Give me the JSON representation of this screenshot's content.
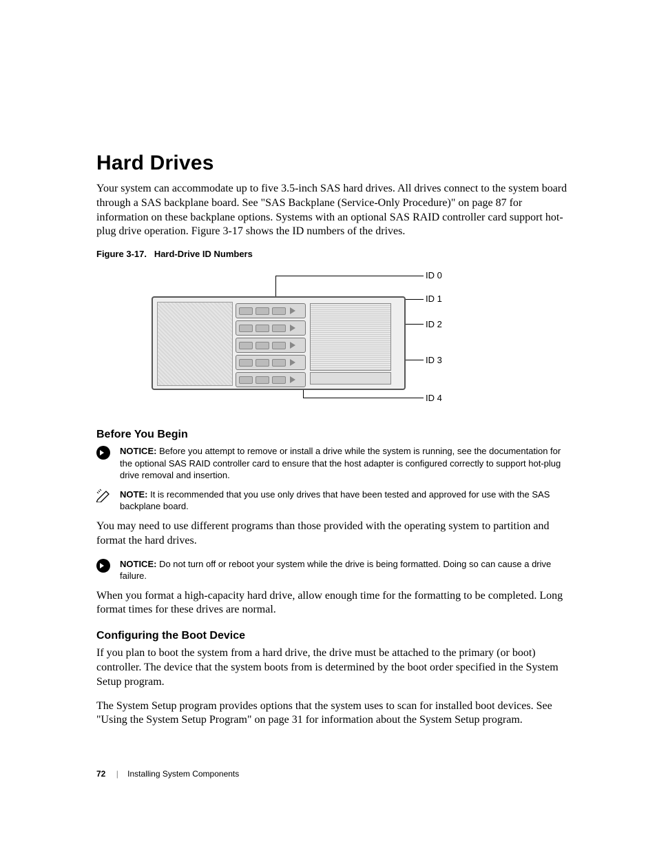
{
  "heading": "Hard Drives",
  "intro": "Your system can accommodate up to five 3.5-inch SAS hard drives. All drives connect to the system board through a SAS backplane board. See \"SAS Backplane (Service-Only Procedure)\" on page 87 for information on these backplane options. Systems with an optional SAS RAID controller card support hot-plug drive operation. Figure 3-17 shows the ID numbers of the drives.",
  "figure_caption_prefix": "Figure 3-17.",
  "figure_caption_text": "Hard-Drive ID Numbers",
  "id_labels": [
    "ID 0",
    "ID 1",
    "ID 2",
    "ID 3",
    "ID 4"
  ],
  "before_heading": "Before You Begin",
  "notice_label": "NOTICE:",
  "note_label": "NOTE:",
  "notice1": "Before you attempt to remove or install a drive while the system is running, see the documentation for the optional SAS RAID controller card to ensure that the host adapter is configured correctly to support hot-plug drive removal and insertion.",
  "note1": "It is recommended that you use only drives that have been tested and approved for use with the SAS backplane board.",
  "body2": "You may need to use different programs than those provided with the operating system to partition and format the hard drives.",
  "notice2": "Do not turn off or reboot your system while the drive is being formatted. Doing so can cause a drive failure.",
  "body3": "When you format a high-capacity hard drive, allow enough time for the formatting to be completed. Long format times for these drives are normal.",
  "config_heading": "Configuring the Boot Device",
  "config_body1": "If you plan to boot the system from a hard drive, the drive must be attached to the primary (or boot) controller. The device that the system boots from is determined by the boot order specified in the System Setup program.",
  "config_body2": "The System Setup program provides options that the system uses to scan for installed boot devices. See \"Using the System Setup Program\" on page 31 for information about the System Setup program.",
  "page_number": "72",
  "footer_section": "Installing System Components"
}
